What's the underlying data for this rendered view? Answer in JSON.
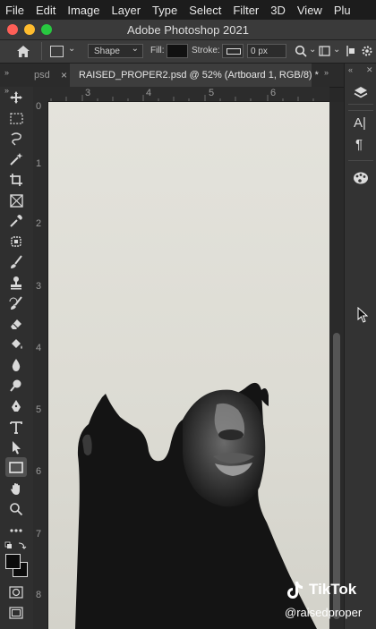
{
  "menu": [
    "File",
    "Edit",
    "Image",
    "Layer",
    "Type",
    "Select",
    "Filter",
    "3D",
    "View",
    "Plu"
  ],
  "window": {
    "title": "Adobe Photoshop 2021"
  },
  "options": {
    "mode": "Shape",
    "fill_label": "Fill:",
    "stroke_label": "Stroke:",
    "stroke_width": "0 px"
  },
  "tabs": {
    "prev": "psd",
    "active": "RAISED_PROPER2.psd @ 52% (Artboard 1, RGB/8) *",
    "close": "×"
  },
  "ruler": {
    "top": [
      "3",
      "4",
      "5",
      "6"
    ],
    "left": [
      "0",
      "1",
      "2",
      "3",
      "4",
      "5",
      "6",
      "7",
      "8"
    ]
  },
  "panel": {
    "char_label": "A|",
    "para_label": "¶"
  },
  "watermark": {
    "brand": "TikTok",
    "handle": "@raisedproper"
  },
  "colors": {
    "artboard": "#e2e1da",
    "silhouette": "#141414",
    "ui_dark": "#2f2f2f"
  }
}
